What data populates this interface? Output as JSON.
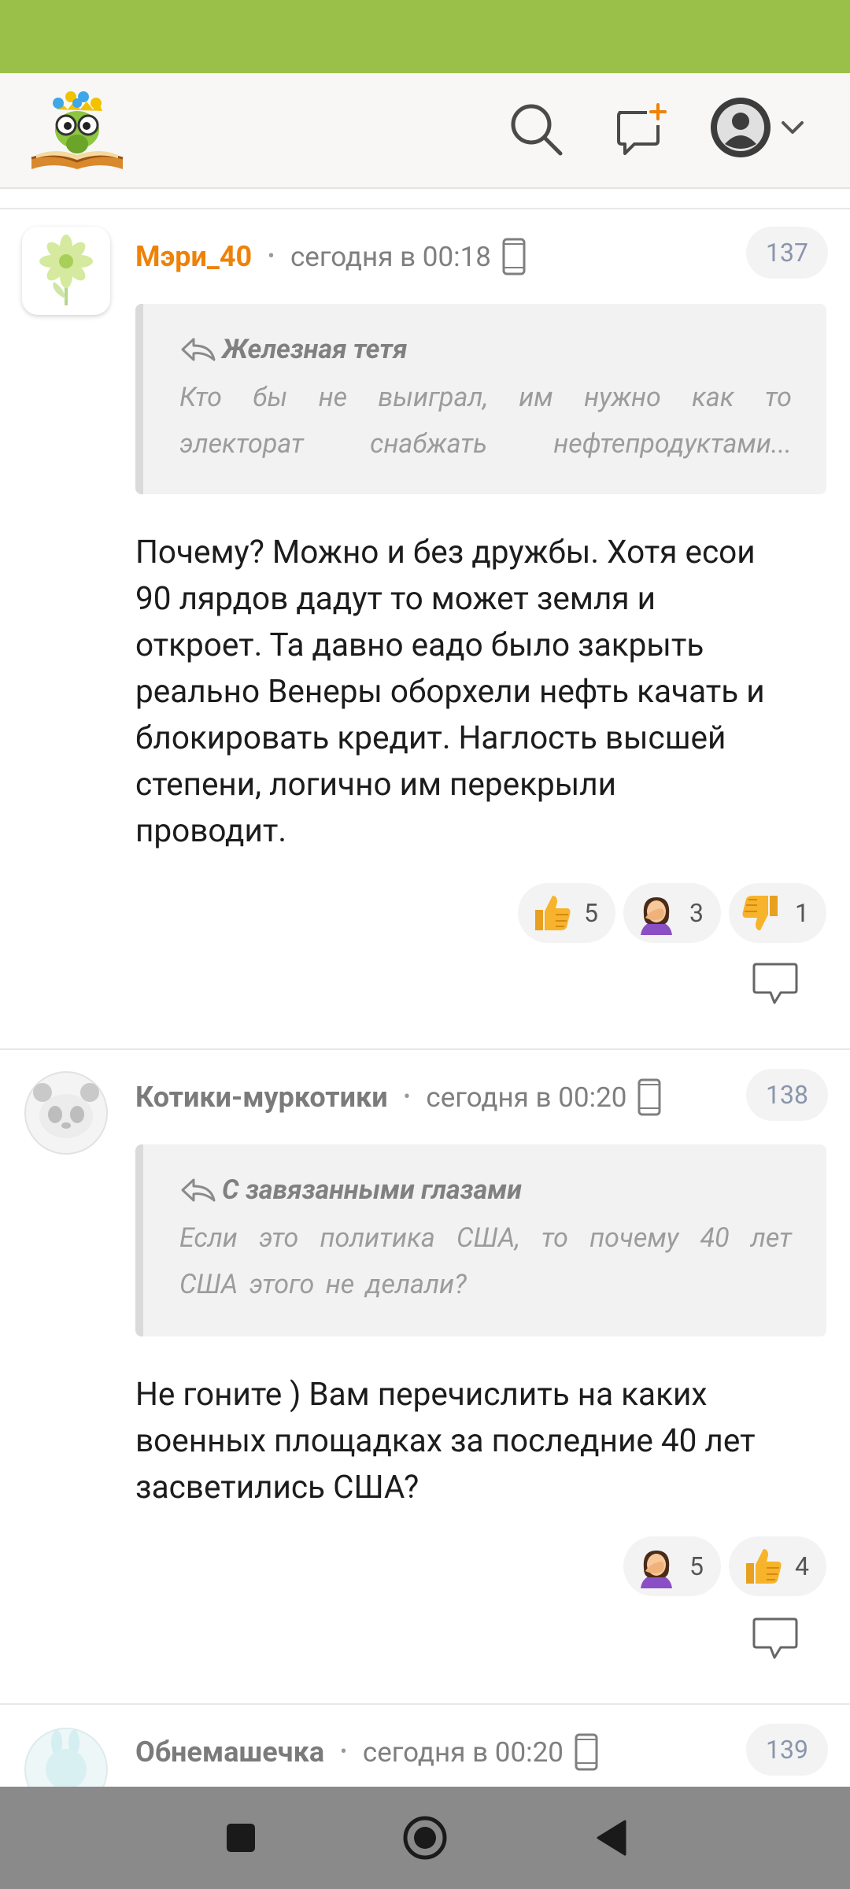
{
  "header": {
    "logo_name": "site-logo",
    "icons": [
      "search-icon",
      "new-post-icon",
      "profile-avatar-icon",
      "chevron-down-icon"
    ]
  },
  "comments": [
    {
      "author": "Мэри_40",
      "time": "сегодня в 00:18",
      "number": "137",
      "quote_author": "Железная тетя",
      "quote_lines": [
        "Кто бы не выиграл, им нужно как то",
        "электорат снабжать нефтепродуктами..."
      ],
      "body_lines": [
        "Почему? Можно и без дружбы. Хотя есои",
        "90 лярдов дадут то может земля и",
        "откроет. Та давно еадо было закрыть",
        "реально Венеры оборхели нефть качать и",
        "блокировать кредит. Наглость высшей",
        "степени, логично им перекрыли",
        "проводит."
      ],
      "reactions": [
        {
          "emoji": "thumbs-up",
          "count": "5"
        },
        {
          "emoji": "facepalm",
          "count": "3"
        },
        {
          "emoji": "thumbs-down",
          "count": "1"
        }
      ]
    },
    {
      "author": "Котики-муркотики",
      "time": "сегодня в 00:20",
      "number": "138",
      "quote_author": "С завязанными глазами",
      "quote_lines": [
        "Если это политика США, то почему 40 лет",
        "США этого не делали?"
      ],
      "body_lines": [
        "Не гоните ) Вам перечислить на каких",
        "военных площадках за последние 40 лет",
        "засветились США?"
      ],
      "reactions": [
        {
          "emoji": "facepalm",
          "count": "5"
        },
        {
          "emoji": "thumbs-up",
          "count": "4"
        }
      ]
    },
    {
      "author": "Обнемашечка",
      "time": "сегодня в 00:20",
      "number": "139"
    }
  ],
  "colors": {
    "status_bar": "#9bc04a",
    "author_accent": "#ee8208",
    "nav_bar": "#8a8a8a"
  }
}
